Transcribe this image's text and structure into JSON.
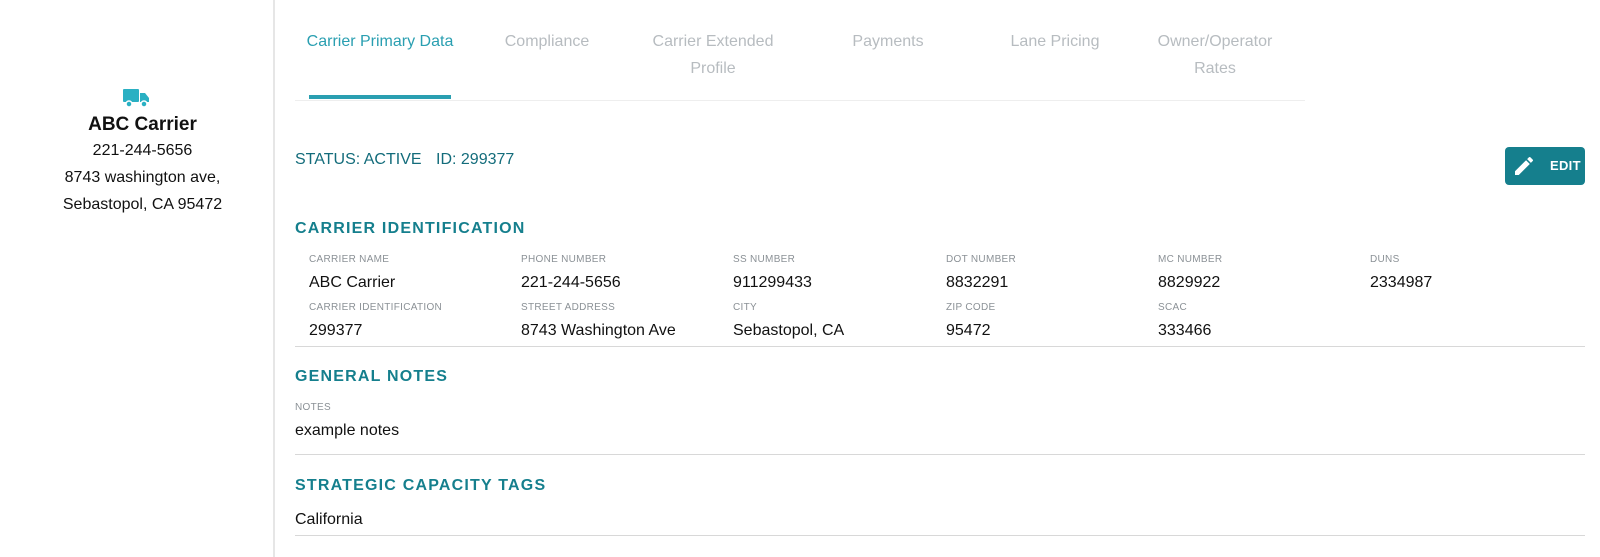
{
  "sidebar": {
    "name": "ABC Carrier",
    "phone": "221-244-5656",
    "address_line1": "8743 washington ave,",
    "address_line2": "Sebastopol, CA 95472",
    "icon": "truck-icon",
    "icon_color": "#2ab0c3"
  },
  "tabs": [
    {
      "label": "Carrier Primary Data",
      "active": true
    },
    {
      "label": "Compliance"
    },
    {
      "label": "Carrier Extended Profile"
    },
    {
      "label": "Payments"
    },
    {
      "label": "Lane Pricing"
    },
    {
      "label": "Owner/Operator Rates"
    }
  ],
  "status": {
    "status": "STATUS: ACTIVE",
    "id": "ID: 299377"
  },
  "edit_label": "EDIT",
  "carrier_identification": {
    "title": "CARRIER IDENTIFICATION",
    "fields": [
      {
        "label": "CARRIER NAME",
        "value": "ABC Carrier"
      },
      {
        "label": "PHONE NUMBER",
        "value": "221-244-5656"
      },
      {
        "label": "SS NUMBER",
        "value": "911299433"
      },
      {
        "label": "DOT NUMBER",
        "value": "8832291"
      },
      {
        "label": "MC NUMBER",
        "value": "8829922"
      },
      {
        "label": "DUNS",
        "value": "2334987"
      },
      {
        "label": "CARRIER IDENTIFICATION",
        "value": "299377"
      },
      {
        "label": "STREET ADDRESS",
        "value": "8743 Washington Ave"
      },
      {
        "label": "CITY",
        "value": "Sebastopol, CA"
      },
      {
        "label": "ZIP CODE",
        "value": "95472"
      },
      {
        "label": "SCAC",
        "value": "333466"
      }
    ]
  },
  "general_notes": {
    "title": "GENERAL NOTES",
    "label": "NOTES",
    "value": "example notes"
  },
  "strategic_capacity": {
    "title": "STRATEGIC CAPACITY TAGS",
    "tag": "California"
  },
  "colors": {
    "accent": "#2a9fb1",
    "heading": "#157f8d",
    "button": "#157f8d"
  }
}
